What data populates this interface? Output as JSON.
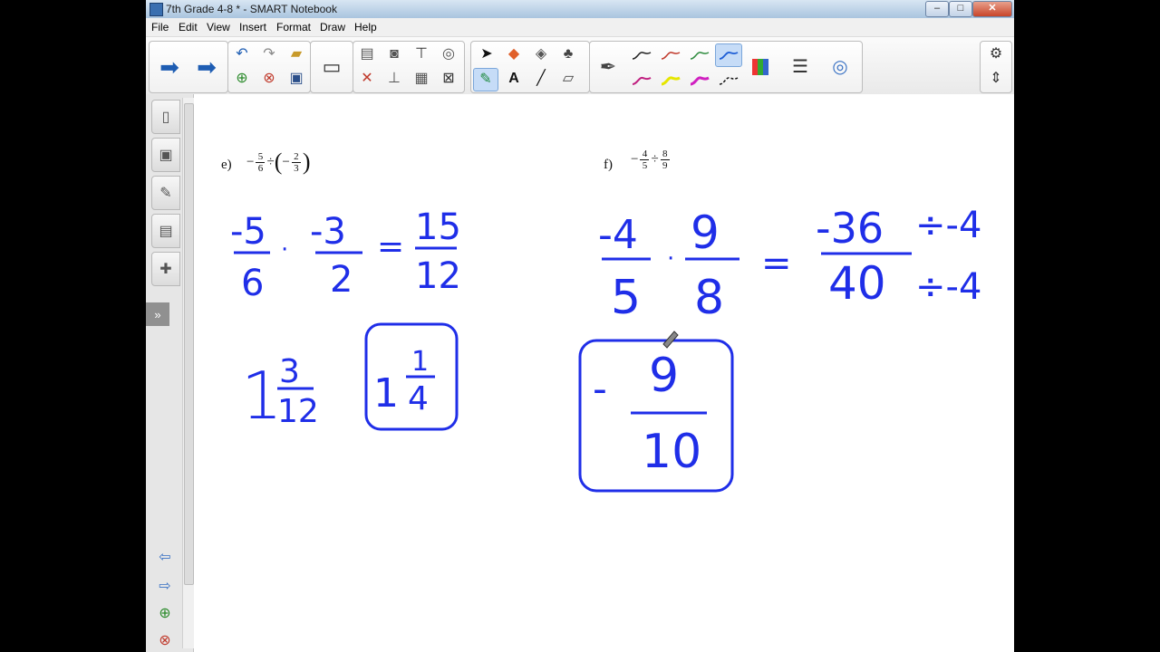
{
  "window": {
    "title": "7th Grade 4-8 * - SMART Notebook"
  },
  "menu": [
    "File",
    "Edit",
    "View",
    "Insert",
    "Format",
    "Draw",
    "Help"
  ],
  "icons": {
    "back": "left-arrow-icon",
    "forward": "right-arrow-icon",
    "undo": "undo-icon",
    "redo": "redo-icon",
    "open": "folder-icon",
    "add_page": "add-page-icon",
    "delete_page": "delete-page-icon",
    "save": "save-icon",
    "screen": "screen-icon",
    "paste": "paste-icon",
    "delete": "delete-x-icon",
    "screen_shade": "screen-shade-icon",
    "capture": "capture-icon",
    "table": "table-icon",
    "clear": "clear-icon",
    "select": "pointer-icon",
    "pens": "pens-icon",
    "text": "text-icon",
    "line": "line-icon",
    "eraser": "eraser-icon",
    "settings": "gear-icon",
    "move_toolbar": "move-arrows-icon"
  },
  "colors": {
    "ink": "#1f2ee8",
    "pen_colors": [
      "#222222",
      "#c0392b",
      "#2e8b3e",
      "#1f5fd6",
      "#c02080",
      "#e6e600",
      "#d020c0",
      "#111111"
    ]
  },
  "problems": {
    "e": {
      "label": "e)",
      "expr": {
        "n1": "5",
        "d1": "6",
        "op": "÷",
        "n2": "2",
        "d2": "3",
        "neg": "−"
      }
    },
    "f": {
      "label": "f)",
      "expr": {
        "n1": "4",
        "d1": "5",
        "op": "÷",
        "n2": "8",
        "d2": "9",
        "neg": "−"
      }
    }
  },
  "ink": {
    "e_step1": {
      "n1": "-5",
      "d1": "6",
      "dot": "·",
      "n2": "-3",
      "d2": "2",
      "eq": "=",
      "n3": "15",
      "d3": "12"
    },
    "e_mixed": {
      "whole": "1",
      "num": "3",
      "den": "12"
    },
    "e_answer": {
      "whole": "1",
      "num": "1",
      "den": "4"
    },
    "f_step1": {
      "n1": "-4",
      "d1": "5",
      "dot": "·",
      "n2": "9",
      "d2": "8",
      "eq": "=",
      "n3": "-36",
      "d3": "40",
      "div_top": "÷-4",
      "div_bot": "÷-4"
    },
    "f_answer": {
      "neg": "-",
      "num": "9",
      "den": "10"
    }
  }
}
